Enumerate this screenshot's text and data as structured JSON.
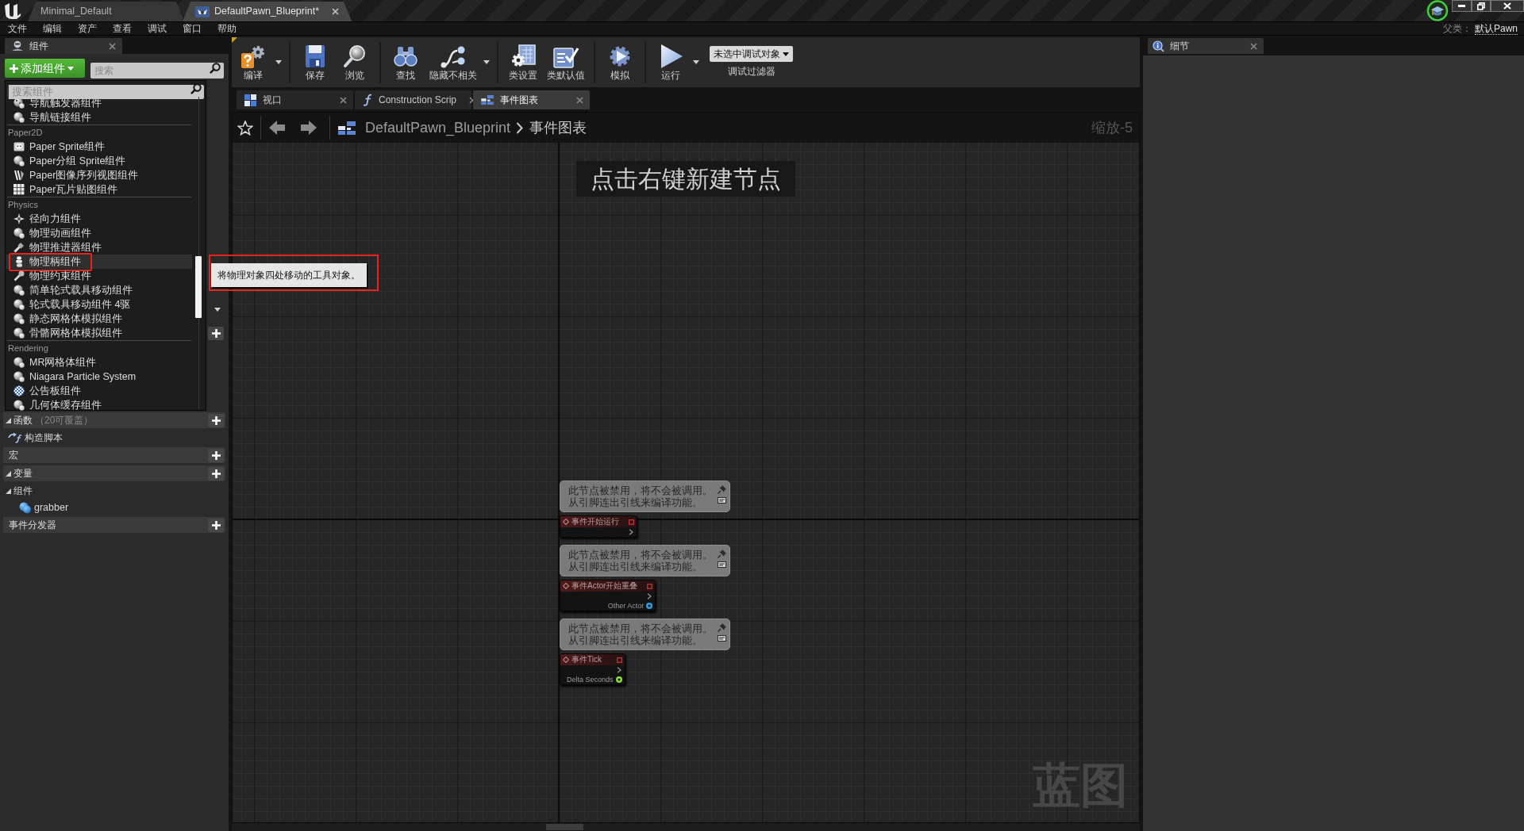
{
  "title_bar": {
    "tabs": [
      {
        "label": "Minimal_Default",
        "kind": "level",
        "selected": false
      },
      {
        "label": "DefaultPawn_Blueprint*",
        "kind": "blueprint",
        "selected": true
      }
    ]
  },
  "menu_bar": {
    "items": [
      "文件",
      "编辑",
      "资产",
      "查看",
      "调试",
      "窗口",
      "帮助"
    ],
    "parent_label": "父类：",
    "parent_value": "默认Pawn"
  },
  "components_panel": {
    "tab": "组件",
    "add_button": "添加组件",
    "search": {
      "placeholder": "搜索"
    }
  },
  "add_component_menu": {
    "search": {
      "placeholder": "搜索组件"
    },
    "entries": [
      {
        "kind": "item",
        "label": "导航触发器组件",
        "hovered": false,
        "marked": false
      },
      {
        "kind": "item",
        "label": "导航链接组件",
        "hovered": false,
        "marked": false
      },
      {
        "kind": "heading",
        "label": "Paper2D"
      },
      {
        "kind": "item",
        "label": "Paper Sprite组件",
        "hovered": false,
        "marked": false
      },
      {
        "kind": "item",
        "label": "Paper分组 Sprite组件",
        "hovered": false,
        "marked": false
      },
      {
        "kind": "item",
        "label": "Paper图像序列视图组件",
        "hovered": false,
        "marked": false
      },
      {
        "kind": "item",
        "label": "Paper瓦片贴图组件",
        "hovered": false,
        "marked": false
      },
      {
        "kind": "heading",
        "label": "Physics"
      },
      {
        "kind": "item",
        "label": "径向力组件",
        "hovered": false,
        "marked": false
      },
      {
        "kind": "item",
        "label": "物理动画组件",
        "hovered": false,
        "marked": false
      },
      {
        "kind": "item",
        "label": "物理推进器组件",
        "hovered": false,
        "marked": false
      },
      {
        "kind": "item",
        "label": "物理柄组件",
        "hovered": true,
        "marked": true
      },
      {
        "kind": "item",
        "label": "物理约束组件",
        "hovered": false,
        "marked": false
      },
      {
        "kind": "item",
        "label": "简单轮式载具移动组件",
        "hovered": false,
        "marked": false
      },
      {
        "kind": "item",
        "label": "轮式载具移动组件 4驱",
        "hovered": false,
        "marked": false
      },
      {
        "kind": "item",
        "label": "静态网格体模拟组件",
        "hovered": false,
        "marked": false
      },
      {
        "kind": "item",
        "label": "骨骼网格体模拟组件",
        "hovered": false,
        "marked": false
      },
      {
        "kind": "heading",
        "label": "Rendering"
      },
      {
        "kind": "item",
        "label": "MR网格体组件",
        "hovered": false,
        "marked": false
      },
      {
        "kind": "item",
        "label": "Niagara Particle System",
        "hovered": false,
        "marked": false
      },
      {
        "kind": "item",
        "label": "公告板组件",
        "hovered": false,
        "marked": false
      },
      {
        "kind": "item",
        "label": "几何体缓存组件",
        "hovered": false,
        "marked": false
      }
    ]
  },
  "tooltip": {
    "text": "将物理对象四处移动的工具对象。",
    "marked": true
  },
  "my_blueprint": {
    "rows": [
      {
        "kind": "covered",
        "addable": true
      },
      {
        "kind": "section",
        "label": "函数",
        "note": "（20可覆盖）",
        "expanded": true,
        "addable": true
      },
      {
        "kind": "function_item",
        "label": "构造脚本"
      },
      {
        "kind": "section",
        "label": "宏",
        "addable": true
      },
      {
        "kind": "section",
        "label": "变量",
        "expanded": true,
        "addable": true
      },
      {
        "kind": "subsection",
        "label": "组件",
        "expanded": true
      },
      {
        "kind": "component_item",
        "label": "grabber"
      },
      {
        "kind": "section",
        "label": "事件分发器",
        "addable": true
      }
    ]
  },
  "toolbar": {
    "groups": [
      {
        "buttons": [
          {
            "label": "编译",
            "has_menu": true
          }
        ]
      },
      {
        "buttons": [
          {
            "label": "保存",
            "has_menu": false
          },
          {
            "label": "浏览",
            "has_menu": false
          }
        ]
      },
      {
        "buttons": [
          {
            "label": "查找",
            "has_menu": false
          },
          {
            "label": "隐藏不相关",
            "has_menu": true
          }
        ]
      },
      {
        "buttons": [
          {
            "label": "类设置",
            "has_menu": false
          },
          {
            "label": "类默认值",
            "has_menu": false
          }
        ]
      },
      {
        "buttons": [
          {
            "label": "模拟",
            "has_menu": false
          }
        ]
      },
      {
        "buttons": [
          {
            "label": "运行",
            "has_menu": true
          }
        ]
      }
    ],
    "debug_filter": {
      "value": "未选中调试对象",
      "label": "调试过滤器"
    }
  },
  "editor_tabs": [
    {
      "label": "视口",
      "kind": "viewport",
      "selected": false
    },
    {
      "label": "Construction Scrip",
      "kind": "function",
      "selected": false
    },
    {
      "label": "事件图表",
      "kind": "graph",
      "selected": true
    }
  ],
  "graph": {
    "breadcrumb": {
      "path": "DefaultPawn_Blueprint",
      "current": "事件图表"
    },
    "zoom": "缩放-5",
    "hint": "点击右键新建节点",
    "graph_type": "蓝图",
    "nodes": [
      {
        "comment_lines": [
          "此节点被禁用，将不会被调用。",
          "从引脚连出引线来编译功能。"
        ],
        "title": "事件开始运行",
        "disabled": true
      },
      {
        "comment_lines": [
          "此节点被禁用，将不会被调用。",
          "从引脚连出引线来编译功能。"
        ],
        "title": "事件Actor开始重叠",
        "disabled": true,
        "pins": [
          {
            "label": "Other Actor",
            "color": "#2f9ee8"
          }
        ]
      },
      {
        "comment_lines": [
          "此节点被禁用，将不会被调用。",
          "从引脚连出引线来编译功能。"
        ],
        "title": "事件Tick",
        "disabled": true,
        "pins": [
          {
            "label": "Delta Seconds",
            "color": "#8fdc3c"
          }
        ]
      }
    ]
  },
  "details_panel": {
    "tab": "细节"
  }
}
